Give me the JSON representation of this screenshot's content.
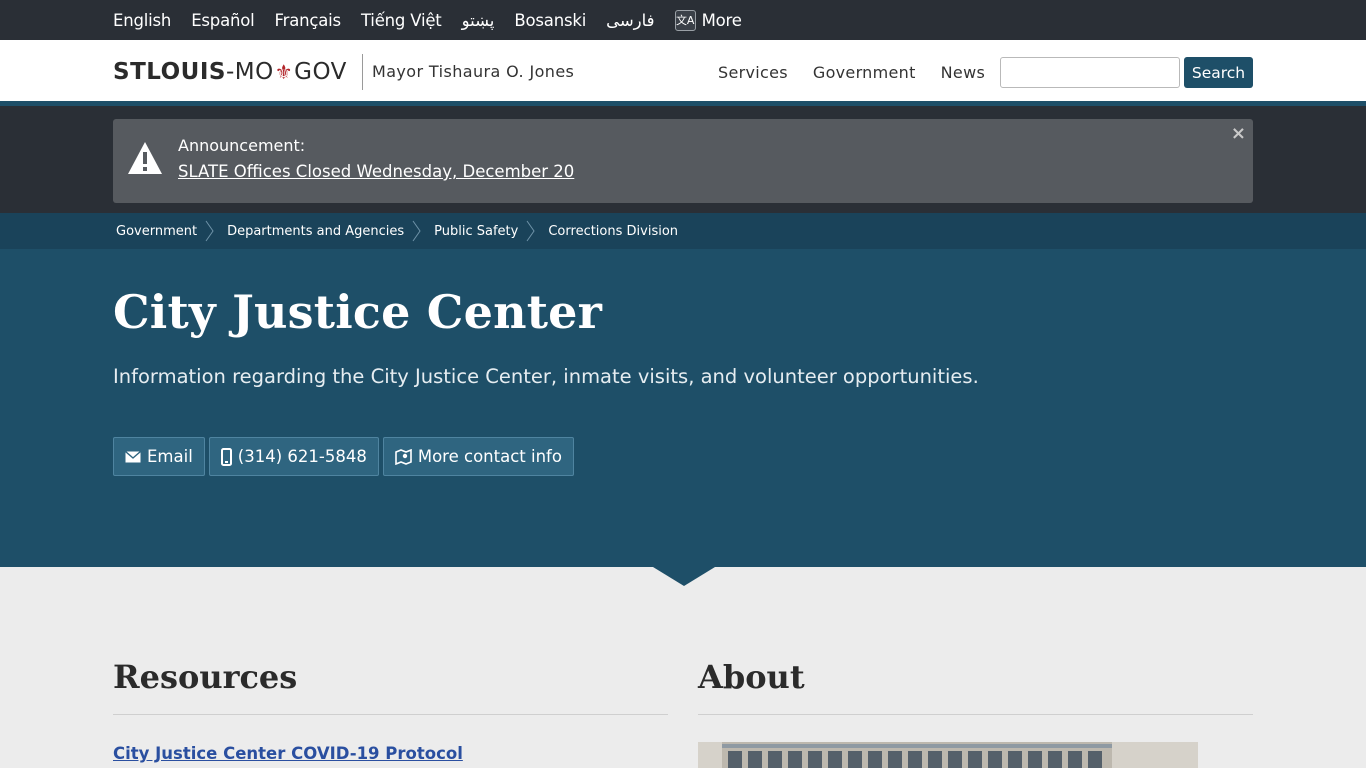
{
  "languages": [
    "English",
    "Español",
    "Français",
    "Tiếng Việt",
    "پښتو",
    "Bosanski",
    "فارسی"
  ],
  "language_more": "More",
  "header": {
    "logo_bold": "STLOUIS",
    "logo_dash": "-MO",
    "logo_gov": "GOV",
    "mayor": "Mayor Tishaura O. Jones",
    "nav": [
      "Services",
      "Government",
      "News"
    ],
    "search_button": "Search",
    "search_value": ""
  },
  "announcement": {
    "title": "Announcement:",
    "link": "SLATE Offices Closed Wednesday, December 20",
    "close": "×"
  },
  "breadcrumbs": [
    "Government",
    "Departments and Agencies",
    "Public Safety",
    "Corrections Division"
  ],
  "hero": {
    "title": "City Justice Center",
    "subtitle": "Information regarding the City Justice Center, inmate visits, and volunteer opportunities.",
    "buttons": [
      {
        "label": "Email",
        "icon": "envelope-icon"
      },
      {
        "label": "(314) 621-5848",
        "icon": "phone-icon"
      },
      {
        "label": "More contact info",
        "icon": "map-icon"
      }
    ]
  },
  "resources": {
    "title": "Resources",
    "links": [
      "City Justice Center COVID-19 Protocol"
    ]
  },
  "about": {
    "title": "About"
  },
  "colors": {
    "dark_bar": "#2a2f36",
    "brand_blue": "#1e4f68",
    "breadcrumb_bg": "#1a435a",
    "accent_red": "#b3262b",
    "link": "#2a4fa0"
  }
}
